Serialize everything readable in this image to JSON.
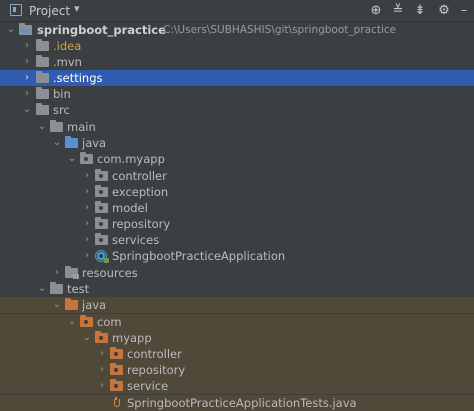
{
  "header": {
    "title": "Project",
    "icons": [
      "target-icon",
      "expand-all-icon",
      "collapse-all-icon",
      "gear-icon",
      "hide-icon"
    ]
  },
  "tree": {
    "project_name": "springboot_practice",
    "project_path": "C:\\Users\\SUBHASHIS\\git\\springboot_practice",
    "items": {
      "idea": ".idea",
      "mvn": ".mvn",
      "settings": ".settings",
      "bin": "bin",
      "src": "src",
      "main": "main",
      "java_main": "java",
      "com_myapp": "com.myapp",
      "controller": "controller",
      "exception": "exception",
      "model": "model",
      "repository": "repository",
      "services": "services",
      "app_class": "SpringbootPracticeApplication",
      "resources": "resources",
      "test": "test",
      "java_test": "java",
      "com": "com",
      "myapp": "myapp",
      "t_controller": "controller",
      "t_repository": "repository",
      "t_service": "service",
      "tests_file": "SpringbootPracticeApplicationTests.java"
    }
  }
}
